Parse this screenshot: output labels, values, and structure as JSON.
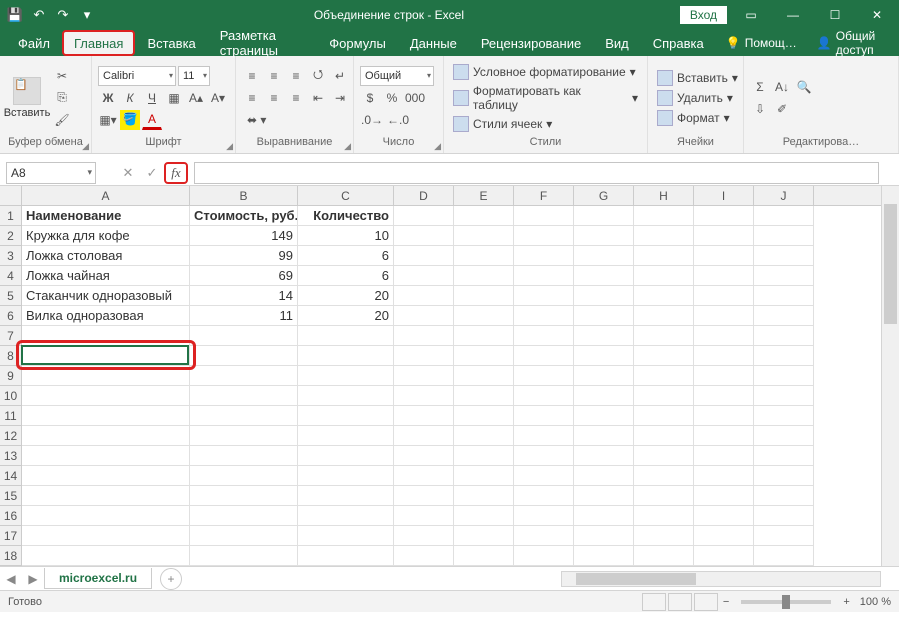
{
  "titlebar": {
    "title": "Объединение строк - Excel",
    "login": "Вход"
  },
  "tabs": {
    "file": "Файл",
    "home": "Главная",
    "insert": "Вставка",
    "layout": "Разметка страницы",
    "formulas": "Формулы",
    "data": "Данные",
    "review": "Рецензирование",
    "view": "Вид",
    "help": "Справка",
    "tellme": "Помощ…",
    "share": "Общий доступ"
  },
  "ribbon": {
    "clipboard": {
      "label": "Буфер обмена",
      "paste": "Вставить"
    },
    "font": {
      "label": "Шрифт",
      "name": "Calibri",
      "size": "11",
      "bold": "Ж",
      "italic": "К",
      "underline": "Ч"
    },
    "alignment": {
      "label": "Выравнивание"
    },
    "number": {
      "label": "Число",
      "format": "Общий"
    },
    "styles": {
      "label": "Стили",
      "conditional": "Условное форматирование",
      "table": "Форматировать как таблицу",
      "cellstyles": "Стили ячеек"
    },
    "cells": {
      "label": "Ячейки",
      "insert": "Вставить",
      "delete": "Удалить",
      "format": "Формат"
    },
    "editing": {
      "label": "Редактирова…"
    }
  },
  "fbar": {
    "name": "A8",
    "cancel": "✕",
    "enter": "✓",
    "fx": "fx"
  },
  "columns": [
    "A",
    "B",
    "C",
    "D",
    "E",
    "F",
    "G",
    "H",
    "I",
    "J"
  ],
  "rows": [
    1,
    2,
    3,
    4,
    5,
    6,
    7,
    8,
    9,
    10,
    11,
    12,
    13,
    14,
    15,
    16,
    17,
    18
  ],
  "data": {
    "header": {
      "a": "Наименование",
      "b": "Стоимость, руб.",
      "c": "Количество"
    },
    "r2": {
      "a": "Кружка для кофе",
      "b": "149",
      "c": "10"
    },
    "r3": {
      "a": "Ложка столовая",
      "b": "99",
      "c": "6"
    },
    "r4": {
      "a": "Ложка чайная",
      "b": "69",
      "c": "6"
    },
    "r5": {
      "a": "Стаканчик одноразовый",
      "b": "14",
      "c": "20"
    },
    "r6": {
      "a": "Вилка одноразовая",
      "b": "11",
      "c": "20"
    }
  },
  "sheet": {
    "name": "microexcel.ru",
    "add": "+"
  },
  "status": {
    "ready": "Готово",
    "zoom": "100 %"
  }
}
